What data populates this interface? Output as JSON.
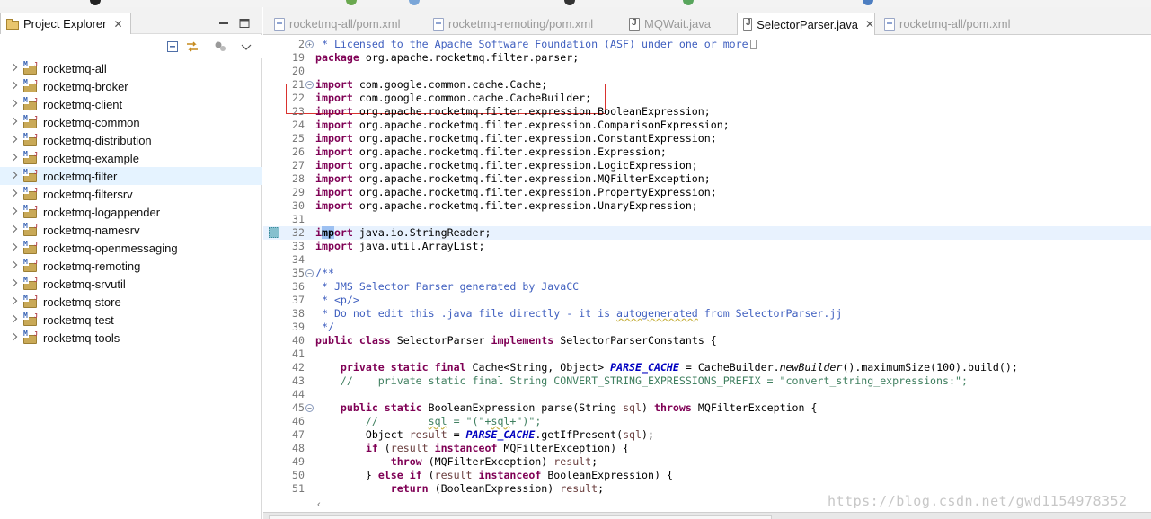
{
  "explorer": {
    "tab_title": "Project Explorer",
    "close_glyph": "✕",
    "items": [
      {
        "label": "rocketmq-all"
      },
      {
        "label": "rocketmq-broker"
      },
      {
        "label": "rocketmq-client"
      },
      {
        "label": "rocketmq-common"
      },
      {
        "label": "rocketmq-distribution"
      },
      {
        "label": "rocketmq-example"
      },
      {
        "label": "rocketmq-filter"
      },
      {
        "label": "rocketmq-filtersrv"
      },
      {
        "label": "rocketmq-logappender"
      },
      {
        "label": "rocketmq-namesrv"
      },
      {
        "label": "rocketmq-openmessaging"
      },
      {
        "label": "rocketmq-remoting"
      },
      {
        "label": "rocketmq-srvutil"
      },
      {
        "label": "rocketmq-store"
      },
      {
        "label": "rocketmq-test"
      },
      {
        "label": "rocketmq-tools"
      }
    ],
    "selected_label": "rocketmq-filter",
    "toolbar_icons": [
      "collapse-all-icon",
      "link-with-editor-icon",
      "filters-icon",
      "view-menu-icon"
    ]
  },
  "editor": {
    "tabs": [
      {
        "label": "rocketmq-all/pom.xml",
        "active": false,
        "closable": false
      },
      {
        "label": "rocketmq-remoting/pom.xml",
        "active": false,
        "closable": false
      },
      {
        "label": "MQWait.java",
        "active": false,
        "closable": false
      },
      {
        "label": "SelectorParser.java",
        "active": true,
        "closable": true
      },
      {
        "label": "rocketmq-all/pom.xml",
        "active": false,
        "closable": false
      }
    ],
    "close_glyph": "✕",
    "current_line": "32",
    "highlighted_lines": [
      "21",
      "22"
    ],
    "lines": [
      {
        "n": "2",
        "text": " * Licensed to the Apache Software Foundation (ASF) under one or more"
      },
      {
        "n": "19",
        "text": "package org.apache.rocketmq.filter.parser;"
      },
      {
        "n": "20",
        "text": ""
      },
      {
        "n": "21",
        "text": "import com.google.common.cache.Cache;"
      },
      {
        "n": "22",
        "text": "import com.google.common.cache.CacheBuilder;"
      },
      {
        "n": "23",
        "text": "import org.apache.rocketmq.filter.expression.BooleanExpression;"
      },
      {
        "n": "24",
        "text": "import org.apache.rocketmq.filter.expression.ComparisonExpression;"
      },
      {
        "n": "25",
        "text": "import org.apache.rocketmq.filter.expression.ConstantExpression;"
      },
      {
        "n": "26",
        "text": "import org.apache.rocketmq.filter.expression.Expression;"
      },
      {
        "n": "27",
        "text": "import org.apache.rocketmq.filter.expression.LogicExpression;"
      },
      {
        "n": "28",
        "text": "import org.apache.rocketmq.filter.expression.MQFilterException;"
      },
      {
        "n": "29",
        "text": "import org.apache.rocketmq.filter.expression.PropertyExpression;"
      },
      {
        "n": "30",
        "text": "import org.apache.rocketmq.filter.expression.UnaryExpression;"
      },
      {
        "n": "31",
        "text": ""
      },
      {
        "n": "32",
        "text": "import java.io.StringReader;"
      },
      {
        "n": "33",
        "text": "import java.util.ArrayList;"
      },
      {
        "n": "34",
        "text": ""
      },
      {
        "n": "35",
        "text": "/**"
      },
      {
        "n": "36",
        "text": " * JMS Selector Parser generated by JavaCC"
      },
      {
        "n": "37",
        "text": " * <p/>"
      },
      {
        "n": "38",
        "text": " * Do not edit this .java file directly - it is autogenerated from SelectorParser.jj"
      },
      {
        "n": "39",
        "text": " */"
      },
      {
        "n": "40",
        "text": "public class SelectorParser implements SelectorParserConstants {"
      },
      {
        "n": "41",
        "text": ""
      },
      {
        "n": "42",
        "text": "    private static final Cache<String, Object> PARSE_CACHE = CacheBuilder.newBuilder().maximumSize(100).build();"
      },
      {
        "n": "43",
        "text": "    //    private static final String CONVERT_STRING_EXPRESSIONS_PREFIX = \"convert_string_expressions:\";"
      },
      {
        "n": "44",
        "text": ""
      },
      {
        "n": "45",
        "text": "    public static BooleanExpression parse(String sql) throws MQFilterException {"
      },
      {
        "n": "46",
        "text": "        //        sql = \"(\"+sql+\")\";"
      },
      {
        "n": "47",
        "text": "        Object result = PARSE_CACHE.getIfPresent(sql);"
      },
      {
        "n": "48",
        "text": "        if (result instanceof MQFilterException) {"
      },
      {
        "n": "49",
        "text": "            throw (MQFilterException) result;"
      },
      {
        "n": "50",
        "text": "        } else if (result instanceof BooleanExpression) {"
      },
      {
        "n": "51",
        "text": "            return (BooleanExpression) result;"
      }
    ]
  },
  "watermark": "https://blog.csdn.net/gwd1154978352",
  "colors": {
    "keyword": "#7f0055",
    "javadoc": "#3f5fbf",
    "line_comment": "#3f7f5f",
    "string": "#2a00ff",
    "static_field": "#0000c0",
    "highlight_box": "#d9322e",
    "selection": "#9dc1f2",
    "current_line": "#e8f2fe"
  }
}
